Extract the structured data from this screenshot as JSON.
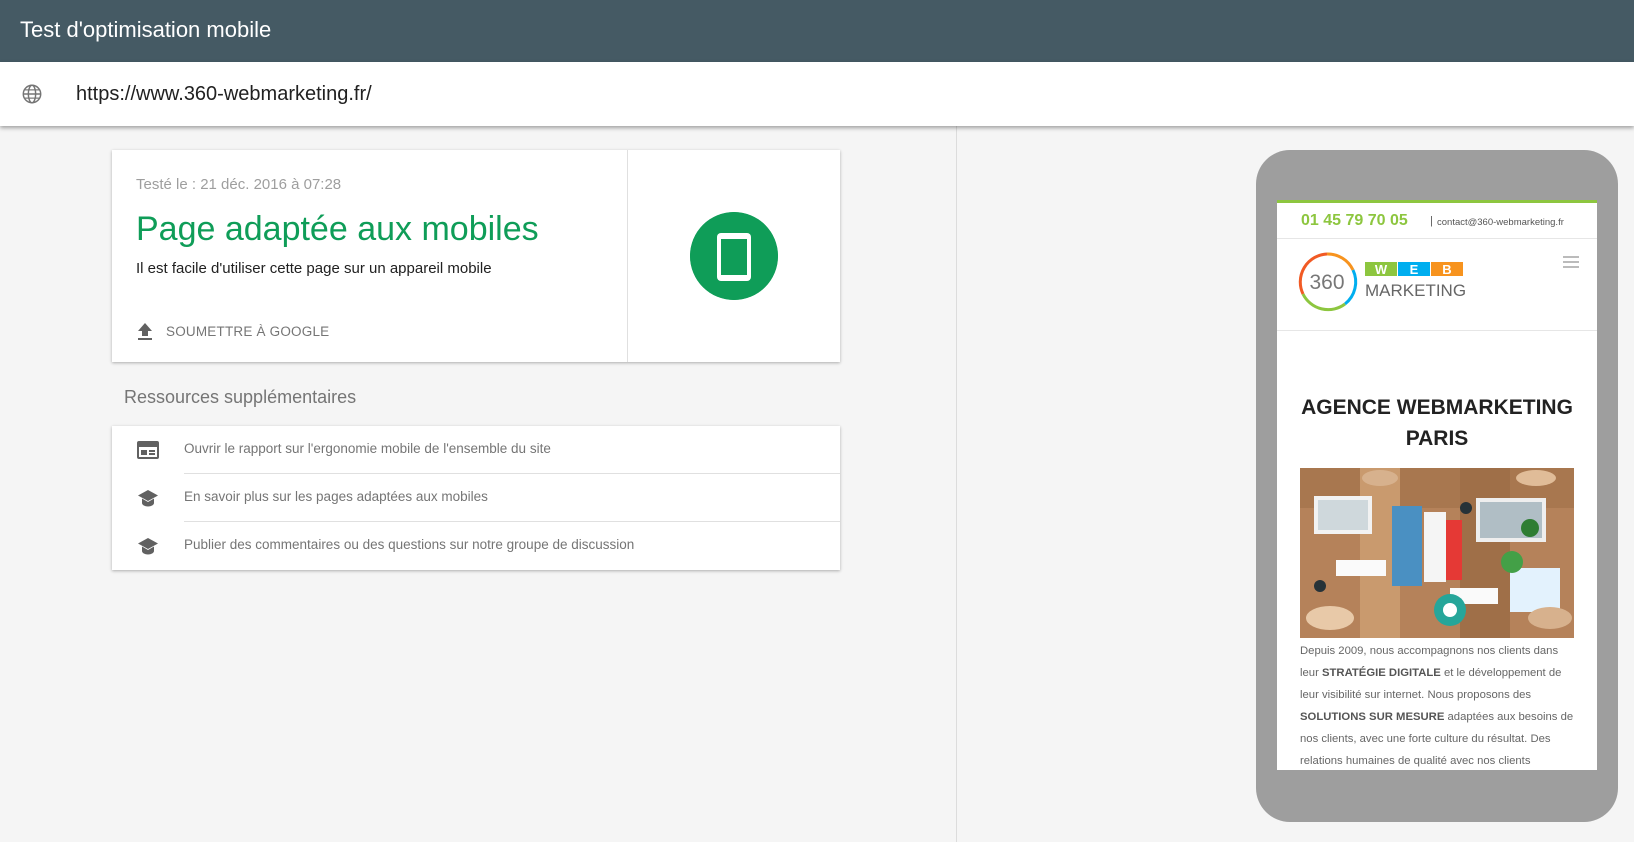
{
  "app": {
    "title": "Test d'optimisation mobile"
  },
  "urlbar": {
    "url": "https://www.360-webmarketing.fr/",
    "icon": "globe-icon"
  },
  "result": {
    "tested_on": "Testé le : 21 déc. 2016 à 07:28",
    "title": "Page adaptée aux mobiles",
    "description": "Il est facile d'utiliser cette page sur un appareil mobile",
    "submit_label": "SOUMETTRE À GOOGLE",
    "status_color": "#0f9d58"
  },
  "resources": {
    "heading": "Ressources supplémentaires",
    "items": [
      {
        "label": "Ouvrir le rapport sur l'ergonomie mobile de l'ensemble du site",
        "icon": "report-icon"
      },
      {
        "label": "En savoir plus sur les pages adaptées aux mobiles",
        "icon": "school-icon"
      },
      {
        "label": "Publier des commentaires ou des questions sur notre groupe de discussion",
        "icon": "school-icon"
      }
    ]
  },
  "preview": {
    "phone": "01 45 79 70 05",
    "separator": "|",
    "email": "contact@360-webmarketing.fr",
    "logo_number": "360",
    "logo_letters": [
      "W",
      "E",
      "B"
    ],
    "logo_word": "MARKETING",
    "heading": "AGENCE WEBMARKETING PARIS",
    "paragraph": {
      "p1": "Depuis 2009, nous accompagnons nos clients dans leur ",
      "b1": "STRATÉGIE DIGITALE",
      "p2": " et le développement de leur visibilité sur internet. Nous proposons des ",
      "b2": "SOLUTIONS SUR MESURE",
      "p3": " adaptées aux besoins de nos clients, avec une forte culture du résultat. Des relations humaines de qualité avec nos clients"
    }
  }
}
